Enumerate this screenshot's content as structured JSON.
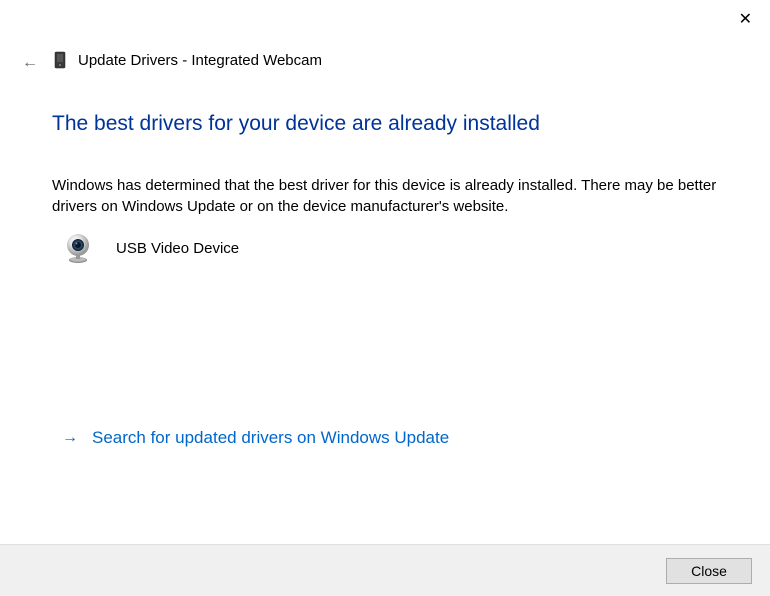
{
  "window": {
    "title": "Update Drivers - Integrated Webcam"
  },
  "content": {
    "heading": "The best drivers for your device are already installed",
    "body": "Windows has determined that the best driver for this device is already installed. There may be better drivers on Windows Update or on the device manufacturer's website.",
    "device_name": "USB Video Device",
    "update_link": "Search for updated drivers on Windows Update"
  },
  "buttons": {
    "close": "Close"
  }
}
